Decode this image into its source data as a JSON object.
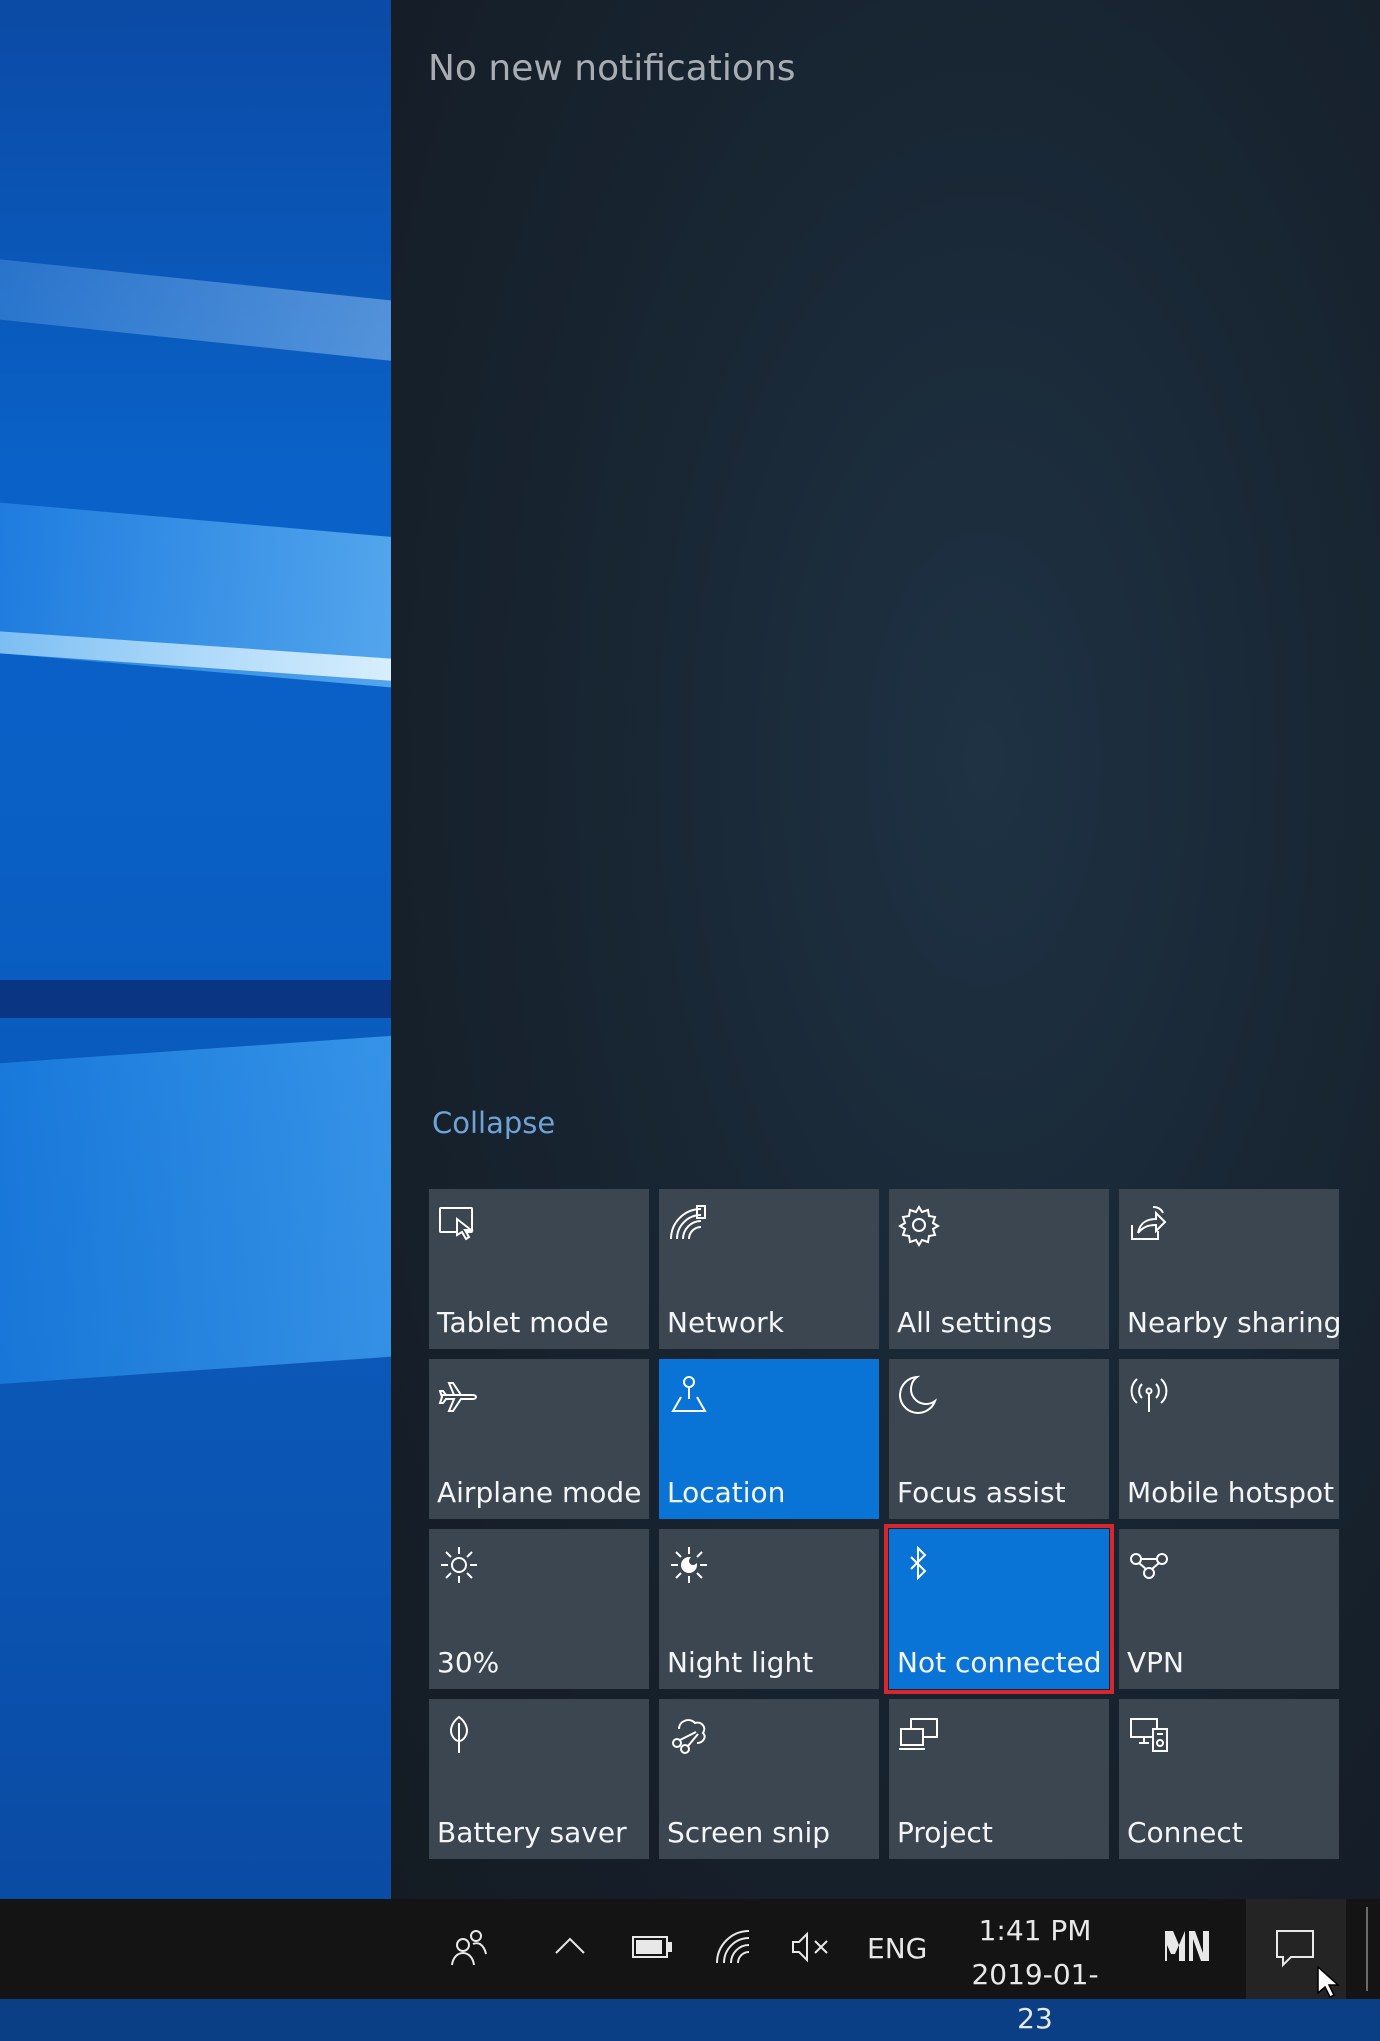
{
  "notifications": {
    "heading": "No new notifications"
  },
  "collapse_label": "Collapse",
  "quick_actions": [
    {
      "label": "Tablet mode",
      "icon": "tablet-mode-icon",
      "active": false
    },
    {
      "label": "Network",
      "icon": "network-icon",
      "active": false
    },
    {
      "label": "All settings",
      "icon": "gear-icon",
      "active": false
    },
    {
      "label": "Nearby sharing",
      "icon": "nearby-sharing-icon",
      "active": false
    },
    {
      "label": "Airplane mode",
      "icon": "airplane-icon",
      "active": false
    },
    {
      "label": "Location",
      "icon": "location-icon",
      "active": true
    },
    {
      "label": "Focus assist",
      "icon": "moon-icon",
      "active": false
    },
    {
      "label": "Mobile hotspot",
      "icon": "hotspot-icon",
      "active": false
    },
    {
      "label": "30%",
      "icon": "brightness-icon",
      "active": false
    },
    {
      "label": "Night light",
      "icon": "night-light-icon",
      "active": false
    },
    {
      "label": "Not connected",
      "icon": "bluetooth-icon",
      "active": true,
      "highlighted": true
    },
    {
      "label": "VPN",
      "icon": "vpn-icon",
      "active": false
    },
    {
      "label": "Battery saver",
      "icon": "battery-saver-icon",
      "active": false
    },
    {
      "label": "Screen snip",
      "icon": "screen-snip-icon",
      "active": false
    },
    {
      "label": "Project",
      "icon": "project-icon",
      "active": false
    },
    {
      "label": "Connect",
      "icon": "connect-icon",
      "active": false
    }
  ],
  "taskbar": {
    "language": "ENG",
    "time": "1:41 PM",
    "date": "2019-01-23",
    "tray_icons": [
      "people-icon",
      "show-hidden-icons-chevron",
      "battery-icon",
      "wifi-icon",
      "volume-muted-icon"
    ]
  },
  "colors": {
    "tile_active": "#0a74d6",
    "tile_inactive": "#3b4650",
    "highlight_border": "#d8262f",
    "collapse_link": "#6fa3d6"
  }
}
